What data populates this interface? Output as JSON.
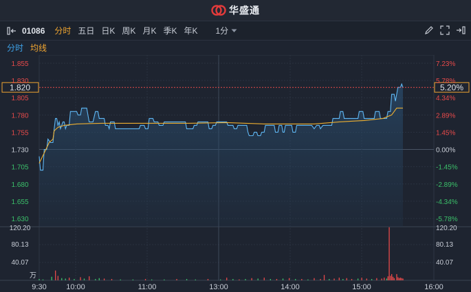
{
  "app": {
    "logo_text": "华盛通"
  },
  "toolbar": {
    "code": "01086",
    "tabs": [
      "分时",
      "五日",
      "日K",
      "周K",
      "月K",
      "季K",
      "年K"
    ],
    "period": "1分"
  },
  "subbar": {
    "minute": "分时",
    "avg": "均线"
  },
  "price_axis": [
    "1.855",
    "1.830",
    "1.805",
    "1.780",
    "1.755",
    "1.730",
    "1.705",
    "1.680",
    "1.655",
    "1.630"
  ],
  "pct_axis": [
    "7.23%",
    "5.78%",
    "4.34%",
    "2.89%",
    "1.45%",
    "0.00%",
    "-1.45%",
    "-2.89%",
    "-4.34%",
    "-5.78%"
  ],
  "current": {
    "price": "1.820",
    "pct": "5.20%"
  },
  "volume_axis": [
    "120.20",
    "80.13",
    "40.07"
  ],
  "volume_unit": "万",
  "time_axis": [
    "9:30",
    "10:00",
    "11:00",
    "13:00",
    "14:00",
    "15:00",
    "16:00"
  ],
  "colors": {
    "up": "#e84a4a",
    "down": "#3bc06a",
    "price_line": "#5fb8f5",
    "avg_line": "#f0b030",
    "bg": "#1e2430",
    "grid": "#2e3644"
  },
  "chart_data": {
    "type": "line",
    "title": "",
    "prev_close": 1.73,
    "ylim": [
      1.618,
      1.867
    ],
    "x_ticks": [
      "9:30",
      "10:00",
      "11:00",
      "13:00",
      "14:00",
      "15:00",
      "16:00"
    ],
    "series": [
      {
        "name": "分时",
        "points": [
          [
            0,
            1.72
          ],
          [
            1,
            1.7
          ],
          [
            3,
            1.7
          ],
          [
            4,
            1.73
          ],
          [
            6,
            1.73
          ],
          [
            7,
            1.745
          ],
          [
            9,
            1.74
          ],
          [
            11,
            1.74
          ],
          [
            12,
            1.76
          ],
          [
            13,
            1.775
          ],
          [
            14,
            1.775
          ],
          [
            15,
            1.765
          ],
          [
            16,
            1.77
          ],
          [
            17,
            1.76
          ],
          [
            18,
            1.765
          ],
          [
            19,
            1.77
          ],
          [
            20,
            1.77
          ],
          [
            21,
            1.76
          ],
          [
            22,
            1.765
          ],
          [
            24,
            1.765
          ],
          [
            25,
            1.785
          ],
          [
            30,
            1.785
          ],
          [
            31,
            1.78
          ],
          [
            33,
            1.78
          ],
          [
            34,
            1.79
          ],
          [
            38,
            1.79
          ],
          [
            40,
            1.77
          ],
          [
            43,
            1.77
          ],
          [
            45,
            1.785
          ],
          [
            47,
            1.785
          ],
          [
            48,
            1.775
          ],
          [
            52,
            1.775
          ],
          [
            53,
            1.765
          ],
          [
            55,
            1.765
          ],
          [
            56,
            1.76
          ],
          [
            57,
            1.77
          ],
          [
            60,
            1.77
          ],
          [
            61,
            1.76
          ],
          [
            68,
            1.76
          ],
          [
            80,
            1.76
          ],
          [
            81,
            1.765
          ],
          [
            84,
            1.765
          ],
          [
            85,
            1.76
          ],
          [
            87,
            1.76
          ],
          [
            88,
            1.775
          ],
          [
            91,
            1.775
          ],
          [
            92,
            1.77
          ],
          [
            95,
            1.77
          ],
          [
            96,
            1.765
          ],
          [
            99,
            1.765
          ],
          [
            100,
            1.77
          ],
          [
            110,
            1.77
          ],
          [
            117,
            1.77
          ],
          [
            118,
            1.76
          ],
          [
            123,
            1.76
          ],
          [
            124,
            1.765
          ],
          [
            126,
            1.765
          ],
          [
            127,
            1.77
          ],
          [
            135,
            1.77
          ],
          [
            136,
            1.76
          ],
          [
            138,
            1.76
          ],
          [
            139,
            1.765
          ],
          [
            141,
            1.765
          ],
          [
            142,
            1.77
          ],
          [
            150,
            1.77
          ],
          [
            151,
            1.765
          ],
          [
            155,
            1.765
          ],
          [
            156,
            1.76
          ],
          [
            158,
            1.76
          ],
          [
            159,
            1.765
          ],
          [
            166,
            1.765
          ],
          [
            167,
            1.755
          ],
          [
            168,
            1.75
          ],
          [
            169,
            1.75
          ],
          [
            171,
            1.75
          ],
          [
            172,
            1.755
          ],
          [
            174,
            1.755
          ],
          [
            175,
            1.75
          ],
          [
            177,
            1.75
          ],
          [
            178,
            1.755
          ],
          [
            180,
            1.755
          ],
          [
            181,
            1.765
          ],
          [
            188,
            1.765
          ],
          [
            189,
            1.755
          ],
          [
            191,
            1.755
          ],
          [
            192,
            1.765
          ],
          [
            194,
            1.765
          ],
          [
            195,
            1.755
          ],
          [
            196,
            1.755
          ],
          [
            197,
            1.765
          ],
          [
            202,
            1.765
          ],
          [
            203,
            1.755
          ],
          [
            205,
            1.755
          ],
          [
            206,
            1.765
          ],
          [
            218,
            1.765
          ],
          [
            220,
            1.76
          ],
          [
            222,
            1.765
          ],
          [
            224,
            1.765
          ],
          [
            225,
            1.76
          ],
          [
            227,
            1.765
          ],
          [
            234,
            1.765
          ],
          [
            235,
            1.775
          ],
          [
            240,
            1.775
          ],
          [
            241,
            1.785
          ],
          [
            243,
            1.785
          ],
          [
            244,
            1.775
          ],
          [
            255,
            1.775
          ],
          [
            256,
            1.785
          ],
          [
            259,
            1.785
          ],
          [
            260,
            1.775
          ],
          [
            268,
            1.775
          ],
          [
            269,
            1.785
          ],
          [
            272,
            1.785
          ],
          [
            273,
            1.775
          ],
          [
            278,
            1.775
          ],
          [
            279,
            1.785
          ],
          [
            281,
            1.785
          ],
          [
            282,
            1.81
          ],
          [
            284,
            1.81
          ],
          [
            285,
            1.8
          ],
          [
            287,
            1.82
          ],
          [
            289,
            1.82
          ],
          [
            290,
            1.825
          ],
          [
            291,
            1.82
          ]
        ]
      },
      {
        "name": "均线",
        "points": [
          [
            0,
            1.71
          ],
          [
            4,
            1.725
          ],
          [
            8,
            1.74
          ],
          [
            11,
            1.745
          ],
          [
            12,
            1.757
          ],
          [
            15,
            1.762
          ],
          [
            20,
            1.765
          ],
          [
            30,
            1.767
          ],
          [
            50,
            1.768
          ],
          [
            80,
            1.768
          ],
          [
            120,
            1.768
          ],
          [
            150,
            1.769
          ],
          [
            180,
            1.767
          ],
          [
            220,
            1.767
          ],
          [
            240,
            1.77
          ],
          [
            260,
            1.772
          ],
          [
            275,
            1.775
          ],
          [
            282,
            1.78
          ],
          [
            286,
            1.79
          ],
          [
            291,
            1.79
          ]
        ]
      }
    ],
    "volume": {
      "unit": "万",
      "ylim": [
        0,
        120.2
      ],
      "bars": [
        [
          0,
          3,
          "down"
        ],
        [
          3,
          2,
          "down"
        ],
        [
          10,
          8,
          "down"
        ],
        [
          13,
          22,
          "up"
        ],
        [
          15,
          10,
          "up"
        ],
        [
          18,
          5,
          "down"
        ],
        [
          21,
          4,
          "down"
        ],
        [
          24,
          6,
          "up"
        ],
        [
          28,
          3,
          "down"
        ],
        [
          33,
          7,
          "up"
        ],
        [
          36,
          4,
          "down"
        ],
        [
          40,
          9,
          "up"
        ],
        [
          45,
          3,
          "down"
        ],
        [
          48,
          5,
          "down"
        ],
        [
          52,
          4,
          "up"
        ],
        [
          58,
          3,
          "up"
        ],
        [
          65,
          2,
          "down"
        ],
        [
          75,
          2,
          "down"
        ],
        [
          85,
          3,
          "up"
        ],
        [
          90,
          2,
          "down"
        ],
        [
          100,
          2,
          "down"
        ],
        [
          110,
          3,
          "up"
        ],
        [
          118,
          3,
          "down"
        ],
        [
          125,
          2,
          "down"
        ],
        [
          135,
          3,
          "up"
        ],
        [
          145,
          2,
          "down"
        ],
        [
          150,
          6,
          "up"
        ],
        [
          155,
          3,
          "down"
        ],
        [
          160,
          2,
          "up"
        ],
        [
          165,
          3,
          "down"
        ],
        [
          170,
          5,
          "up"
        ],
        [
          175,
          4,
          "down"
        ],
        [
          180,
          6,
          "up"
        ],
        [
          185,
          3,
          "down"
        ],
        [
          190,
          3,
          "up"
        ],
        [
          195,
          4,
          "down"
        ],
        [
          200,
          5,
          "up"
        ],
        [
          205,
          3,
          "down"
        ],
        [
          210,
          3,
          "up"
        ],
        [
          215,
          2,
          "down"
        ],
        [
          220,
          5,
          "up"
        ],
        [
          225,
          3,
          "up"
        ],
        [
          228,
          12,
          "up"
        ],
        [
          232,
          3,
          "down"
        ],
        [
          236,
          4,
          "up"
        ],
        [
          240,
          6,
          "up"
        ],
        [
          243,
          3,
          "down"
        ],
        [
          246,
          5,
          "up"
        ],
        [
          250,
          3,
          "up"
        ],
        [
          255,
          4,
          "down"
        ],
        [
          258,
          6,
          "up"
        ],
        [
          262,
          4,
          "up"
        ],
        [
          266,
          3,
          "down"
        ],
        [
          270,
          5,
          "up"
        ],
        [
          274,
          4,
          "up"
        ],
        [
          276,
          6,
          "up"
        ],
        [
          278,
          4,
          "down"
        ],
        [
          279,
          9,
          "up"
        ],
        [
          280,
          119,
          "up"
        ],
        [
          281,
          10,
          "up"
        ],
        [
          282,
          14,
          "up"
        ],
        [
          283,
          8,
          "up"
        ],
        [
          284,
          5,
          "up"
        ],
        [
          286,
          14,
          "up"
        ],
        [
          287,
          7,
          "up"
        ],
        [
          288,
          5,
          "up"
        ],
        [
          289,
          6,
          "up"
        ],
        [
          290,
          5,
          "up"
        ],
        [
          291,
          4,
          "up"
        ]
      ]
    }
  }
}
